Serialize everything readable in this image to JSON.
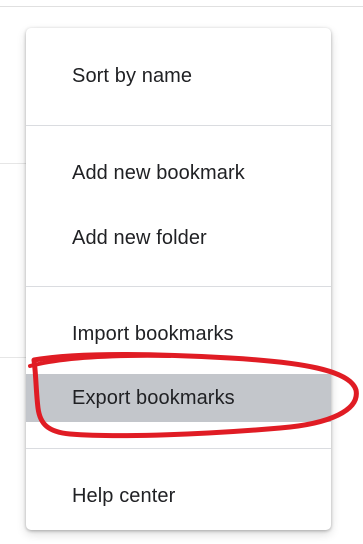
{
  "menu": {
    "items": [
      {
        "label": "Sort by name"
      },
      {
        "label": "Add new bookmark"
      },
      {
        "label": "Add new folder"
      },
      {
        "label": "Import bookmarks"
      },
      {
        "label": "Export bookmarks"
      },
      {
        "label": "Help center"
      }
    ],
    "highlighted_index": 4
  },
  "colors": {
    "highlight": "#c3c6cb",
    "annotation": "#e01c24",
    "text": "#202124"
  }
}
